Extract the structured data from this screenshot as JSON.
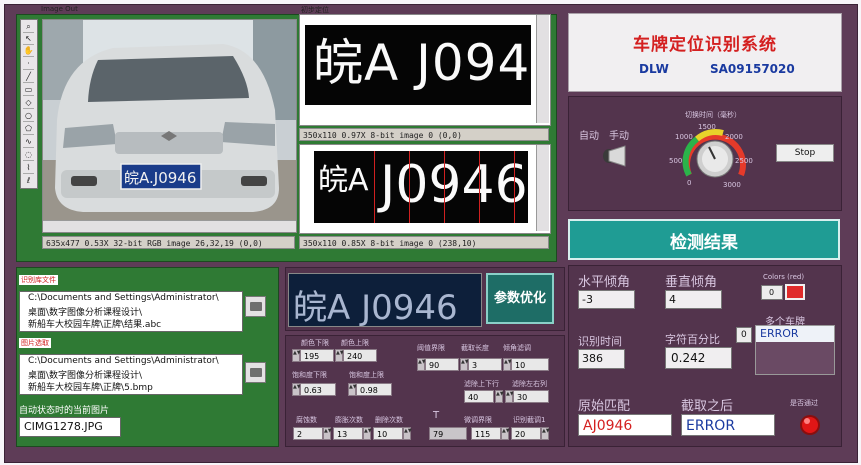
{
  "image_out": {
    "label": "Image Out",
    "status": "635x477 0.53X 32-bit RGB image 26,32,19     (0,0)",
    "plate_text": "皖A.J0946"
  },
  "binary_panel": {
    "label": "初步定位",
    "top_status": "350x110 0.97X 8-bit image 0     (0,0)",
    "bottom_status": "350x110 0.85X 8-bit image 0     (238,10)",
    "top_plate_text": "皖A J0946",
    "bottom_plate_text": "J0946",
    "bottom_plate_prefix": "皖A"
  },
  "title": {
    "main": "车牌定位识别系统",
    "author": "DLW",
    "id": "SA09157020"
  },
  "mode": {
    "auto": "自动",
    "manual": "手动",
    "dial_label": "切换时间（毫秒）",
    "dial_ticks": [
      "0",
      "500",
      "1000",
      "1500",
      "2000",
      "2500",
      "3000"
    ],
    "stop": "Stop"
  },
  "files": {
    "lib_label": "识别库文件",
    "lib_path": [
      "C:\\Documents and Settings\\Administrator\\",
      "桌面\\数字图像分析课程设计\\",
      "新船车大校园车牌\\正牌\\结果.abc"
    ],
    "img_label": "图片选取",
    "img_path": [
      "C:\\Documents and Settings\\Administrator\\",
      "桌面\\数字图像分析课程设计\\",
      "新船车大校园车牌\\正牌\\5.bmp"
    ],
    "current_label": "自动状态时的当前图片",
    "current_value": "CIMG1278.JPG"
  },
  "plate_preview": {
    "text": "皖A J0946"
  },
  "optimize_button": "参数优化",
  "params": {
    "color_low_label": "颜色下限",
    "color_low": "195",
    "color_high_label": "颜色上限",
    "color_high": "240",
    "sat_low_label": "饱和度下限",
    "sat_low": "0.63",
    "sat_high_label": "饱和度上限",
    "sat_high": "0.98",
    "thresh_label": "阈值界限",
    "thresh": "90",
    "cut_len_label": "截取长度",
    "cut_len": "3",
    "tilt_label": "倾角滤调",
    "tilt": "10",
    "edge_ud_label": "滤除上下行",
    "edge_ud": "40",
    "edge_lr_label": "滤除左右列",
    "edge_lr": "30",
    "erode_label": "腐蚀数",
    "erode": "2",
    "cycles_label": "膨胀次数",
    "cycles": "13",
    "iter_label": "删除次数",
    "iter": "10",
    "t_label": "T",
    "t": "79",
    "fine_label": "微调界限",
    "fine": "115",
    "recog_label": "识别截调1",
    "recog": "20"
  },
  "results": {
    "header": "检测结果",
    "h_angle_label": "水平倾角",
    "h_angle": "-3",
    "v_angle_label": "垂直倾角",
    "v_angle": "4",
    "colors_label": "Colors (red)",
    "colors_value": "0",
    "time_label": "识别时间",
    "time": "386",
    "char_pct_label": "字符百分比",
    "char_pct": "0.242",
    "multi_label": "多个车牌",
    "multi_index": "0",
    "multi_items": [
      "ERROR",
      "",
      ""
    ],
    "orig_label": "原始匹配",
    "orig_value": "AJ0946",
    "after_label": "截取之后",
    "after_value": "ERROR",
    "pass_label": "是否通过",
    "accent_red": "#e03030",
    "accent_blue": "#1a3aa0"
  },
  "toolbar_icons": [
    "zoom-icon",
    "arrow-icon",
    "pan-icon",
    "point-icon",
    "line-icon",
    "rect-icon",
    "rotated-rect-icon",
    "oval-icon",
    "polygon-icon",
    "freehand-icon",
    "annulus-icon",
    "broken-line-icon",
    "freeline-icon"
  ]
}
